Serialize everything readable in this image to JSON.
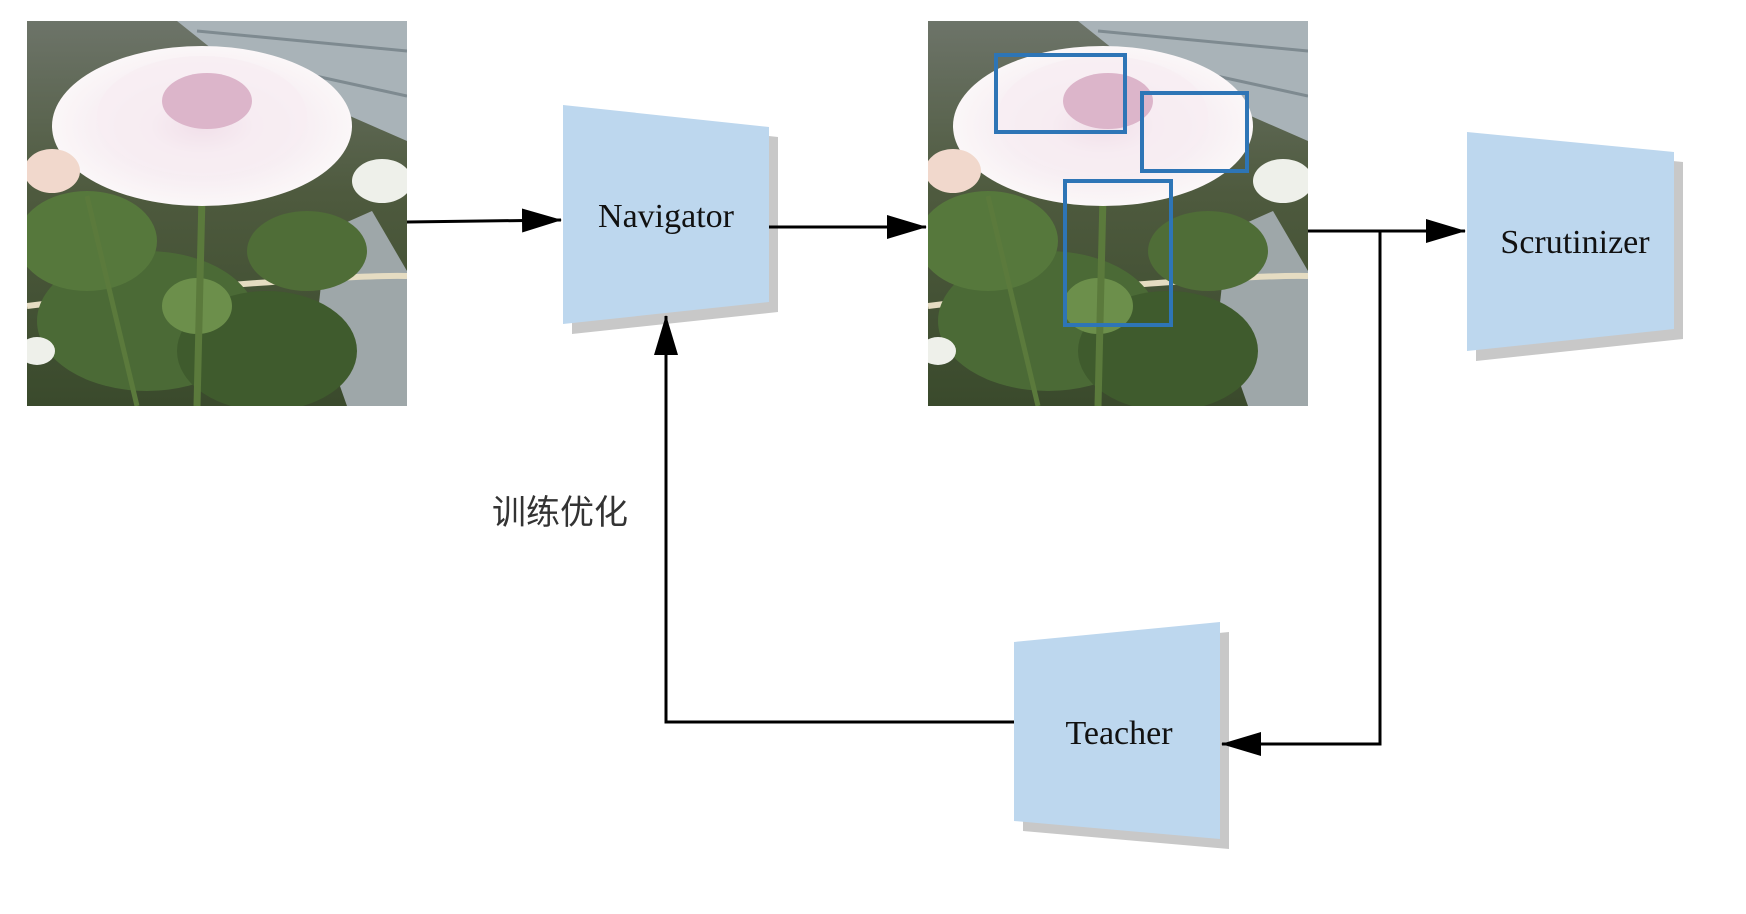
{
  "diagram": {
    "modules": {
      "navigator": {
        "label": "Navigator"
      },
      "scrutinizer": {
        "label": "Scrutinizer"
      },
      "teacher": {
        "label": "Teacher"
      }
    },
    "feedback_label": "训练优化",
    "images": {
      "input": {
        "content": "white chrysanthemum photo"
      },
      "proposals": {
        "content": "white chrysanthemum photo with three blue region boxes"
      }
    },
    "colors": {
      "module_fill": "#bdd7ee",
      "module_shadow": "#c8c8c8",
      "region_box": "#2e75b6",
      "arrow": "#000000"
    }
  }
}
